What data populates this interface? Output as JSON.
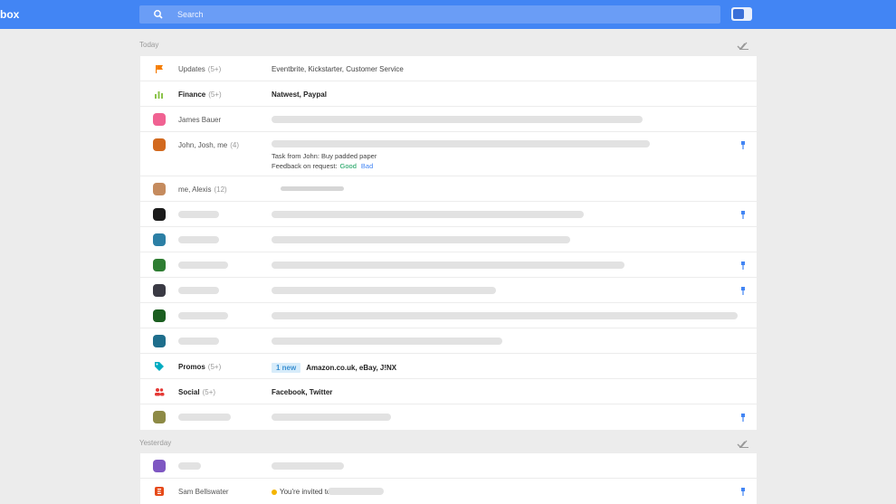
{
  "app": {
    "title": "box"
  },
  "search": {
    "placeholder": "Search"
  },
  "sections": {
    "today": "Today",
    "yesterday": "Yesterday"
  },
  "rows": [
    {
      "sender": "Updates",
      "count": "(5+)",
      "subject": "Eventbrite, Kickstarter, Customer Service",
      "icon": "flag-icon"
    },
    {
      "sender": "Finance",
      "count": "(5+)",
      "subject": "Natwest, Paypal",
      "icon": "finance-chart-icon"
    },
    {
      "sender": "James Bauer",
      "count": "",
      "subject": "",
      "icon": "avatar"
    },
    {
      "sender": "John, Josh, me",
      "count": "(4)",
      "subject": "",
      "task": "Task from John: Buy padded paper",
      "feedback": "Feedback on request:",
      "good": "Good",
      "bad": "Bad",
      "icon": "avatar"
    },
    {
      "sender": "me, Alexis",
      "count": "(12)",
      "subject": "",
      "icon": "avatar"
    },
    {
      "sender": "Promos",
      "count": "(5+)",
      "badge": "1 new",
      "subject": "Amazon.co.uk, eBay, J!NX",
      "icon": "tag-icon"
    },
    {
      "sender": "Social",
      "count": "(5+)",
      "subject": "Facebook, Twitter",
      "icon": "people-icon"
    }
  ],
  "yesterday_rows": [
    {
      "sender": "Sam Bellswater",
      "subject": "You're invited to",
      "icon": "event-icon"
    }
  ],
  "colors": {
    "accent": "#4285f4",
    "good": "#0f9d58",
    "bad": "#4285f4",
    "background": "#ececec"
  }
}
